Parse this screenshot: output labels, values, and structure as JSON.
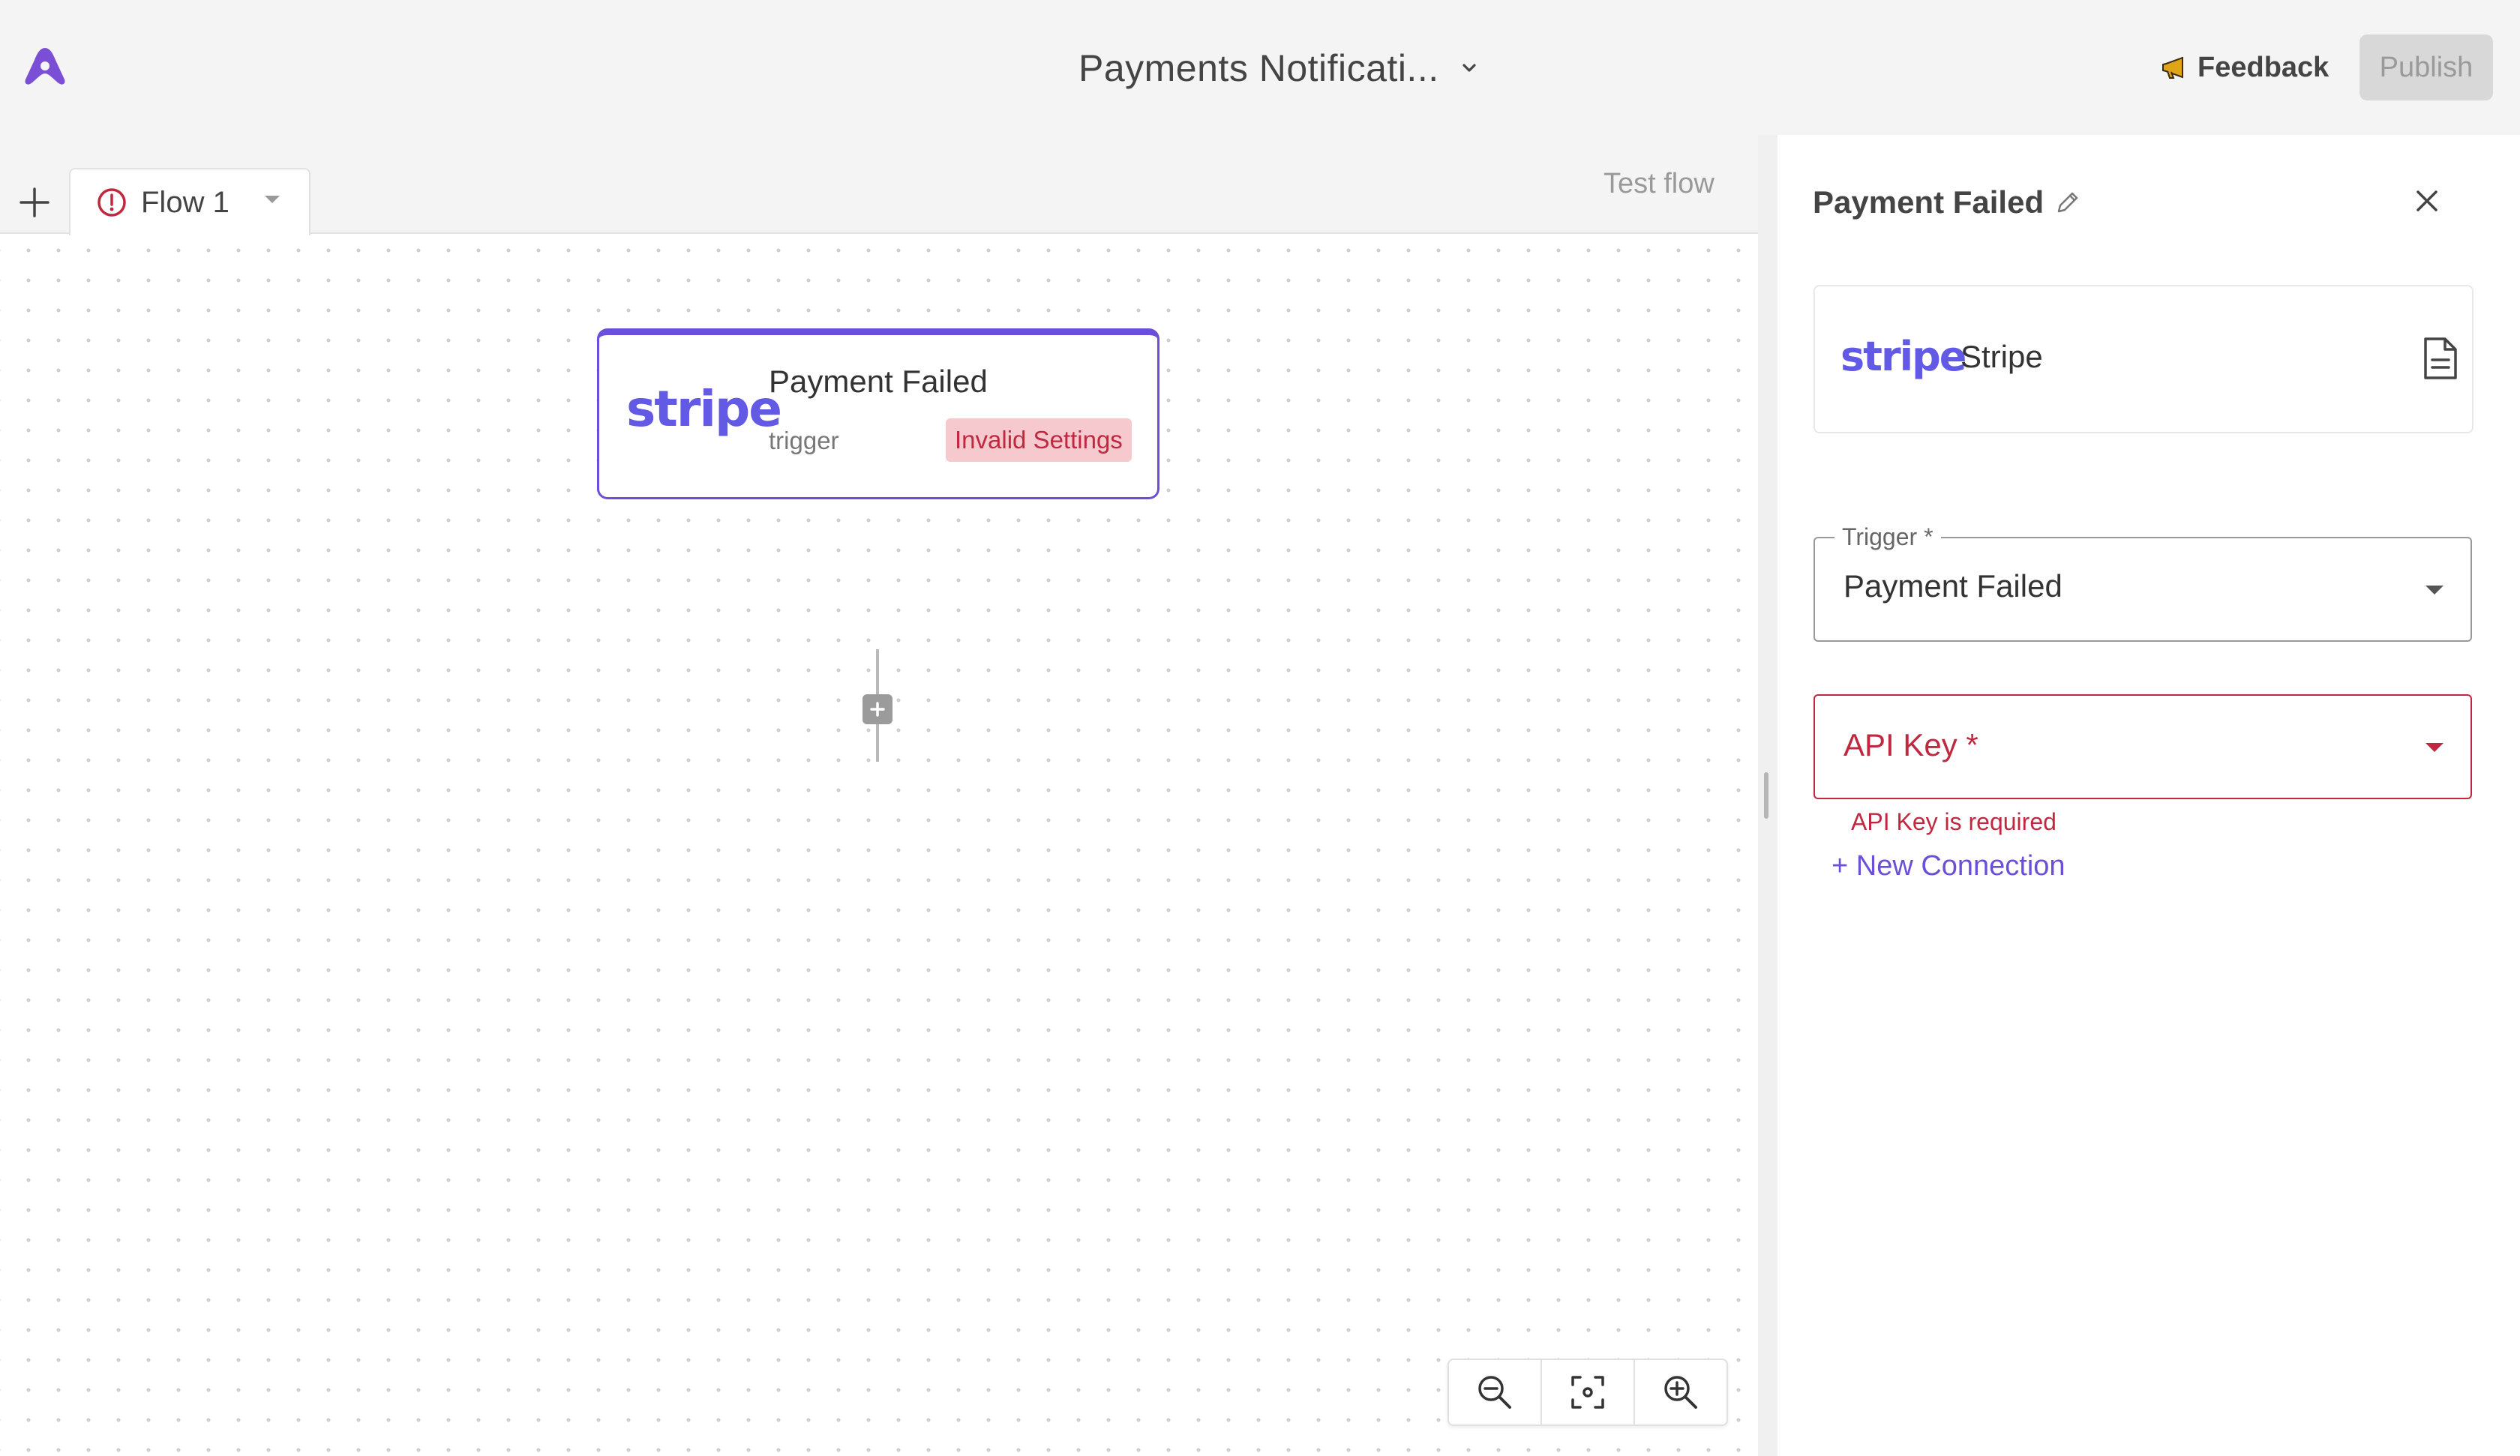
{
  "header": {
    "logo_icon": "activepieces-logo-icon",
    "title": "Payments Notificati...",
    "title_chevron_icon": "chevron-down-icon",
    "feedback_label": "Feedback",
    "feedback_icon": "megaphone-icon",
    "publish_label": "Publish"
  },
  "tabs": {
    "add_icon": "plus-icon",
    "items": [
      {
        "label": "Flow 1",
        "status_icon": "error-circle-icon",
        "menu_icon": "caret-down-icon"
      }
    ],
    "test_flow_label": "Test flow"
  },
  "canvas": {
    "step": {
      "logo_text": "stripe",
      "title": "Payment Failed",
      "type": "trigger",
      "badge": "Invalid Settings"
    },
    "zoom_controls": [
      "zoom-out-icon",
      "fit-view-icon",
      "zoom-in-icon"
    ]
  },
  "panel": {
    "title": "Payment Failed",
    "edit_icon": "pencil-icon",
    "close_icon": "close-icon",
    "piece": {
      "logo_text": "stripe",
      "name": "Stripe",
      "doc_icon": "document-icon"
    },
    "trigger_field": {
      "label": "Trigger *",
      "value": "Payment Failed"
    },
    "api_key_field": {
      "placeholder": "API Key *",
      "error": "API Key is required"
    },
    "new_connection_label": "+ New Connection"
  },
  "colors": {
    "accent": "#6b4fd8",
    "stripe": "#6259e4",
    "error": "#c0283f",
    "error_bg": "#f6c9cf"
  }
}
